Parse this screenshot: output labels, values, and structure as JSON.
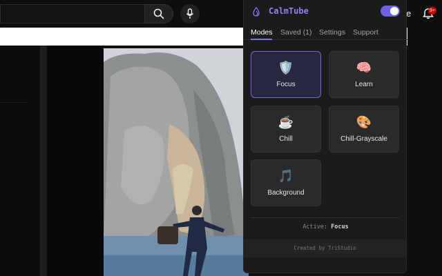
{
  "youtube": {
    "create_partial": "e",
    "notification_badge": "9+"
  },
  "extension": {
    "name": "CalmTube",
    "enabled": true,
    "accent_color": "#6a63e6",
    "tabs": [
      {
        "label": "Modes",
        "active": true
      },
      {
        "label": "Saved (1)",
        "active": false
      },
      {
        "label": "Settings",
        "active": false
      },
      {
        "label": "Support",
        "active": false
      }
    ],
    "modes": [
      {
        "label": "Focus",
        "icon": "🛡️",
        "icon_name": "shield-icon",
        "selected": true
      },
      {
        "label": "Learn",
        "icon": "🧠",
        "icon_name": "brain-icon",
        "selected": false
      },
      {
        "label": "Chill",
        "icon": "☕",
        "icon_name": "coffee-icon",
        "selected": false
      },
      {
        "label": "Chill-Grayscale",
        "icon": "🎨",
        "icon_name": "palette-icon",
        "selected": false
      },
      {
        "label": "Background",
        "icon": "🎵",
        "icon_name": "music-note-icon",
        "selected": false
      }
    ],
    "status": {
      "prefix": "Active: ",
      "mode": "Focus"
    },
    "footer": "Created by TriStudio"
  }
}
